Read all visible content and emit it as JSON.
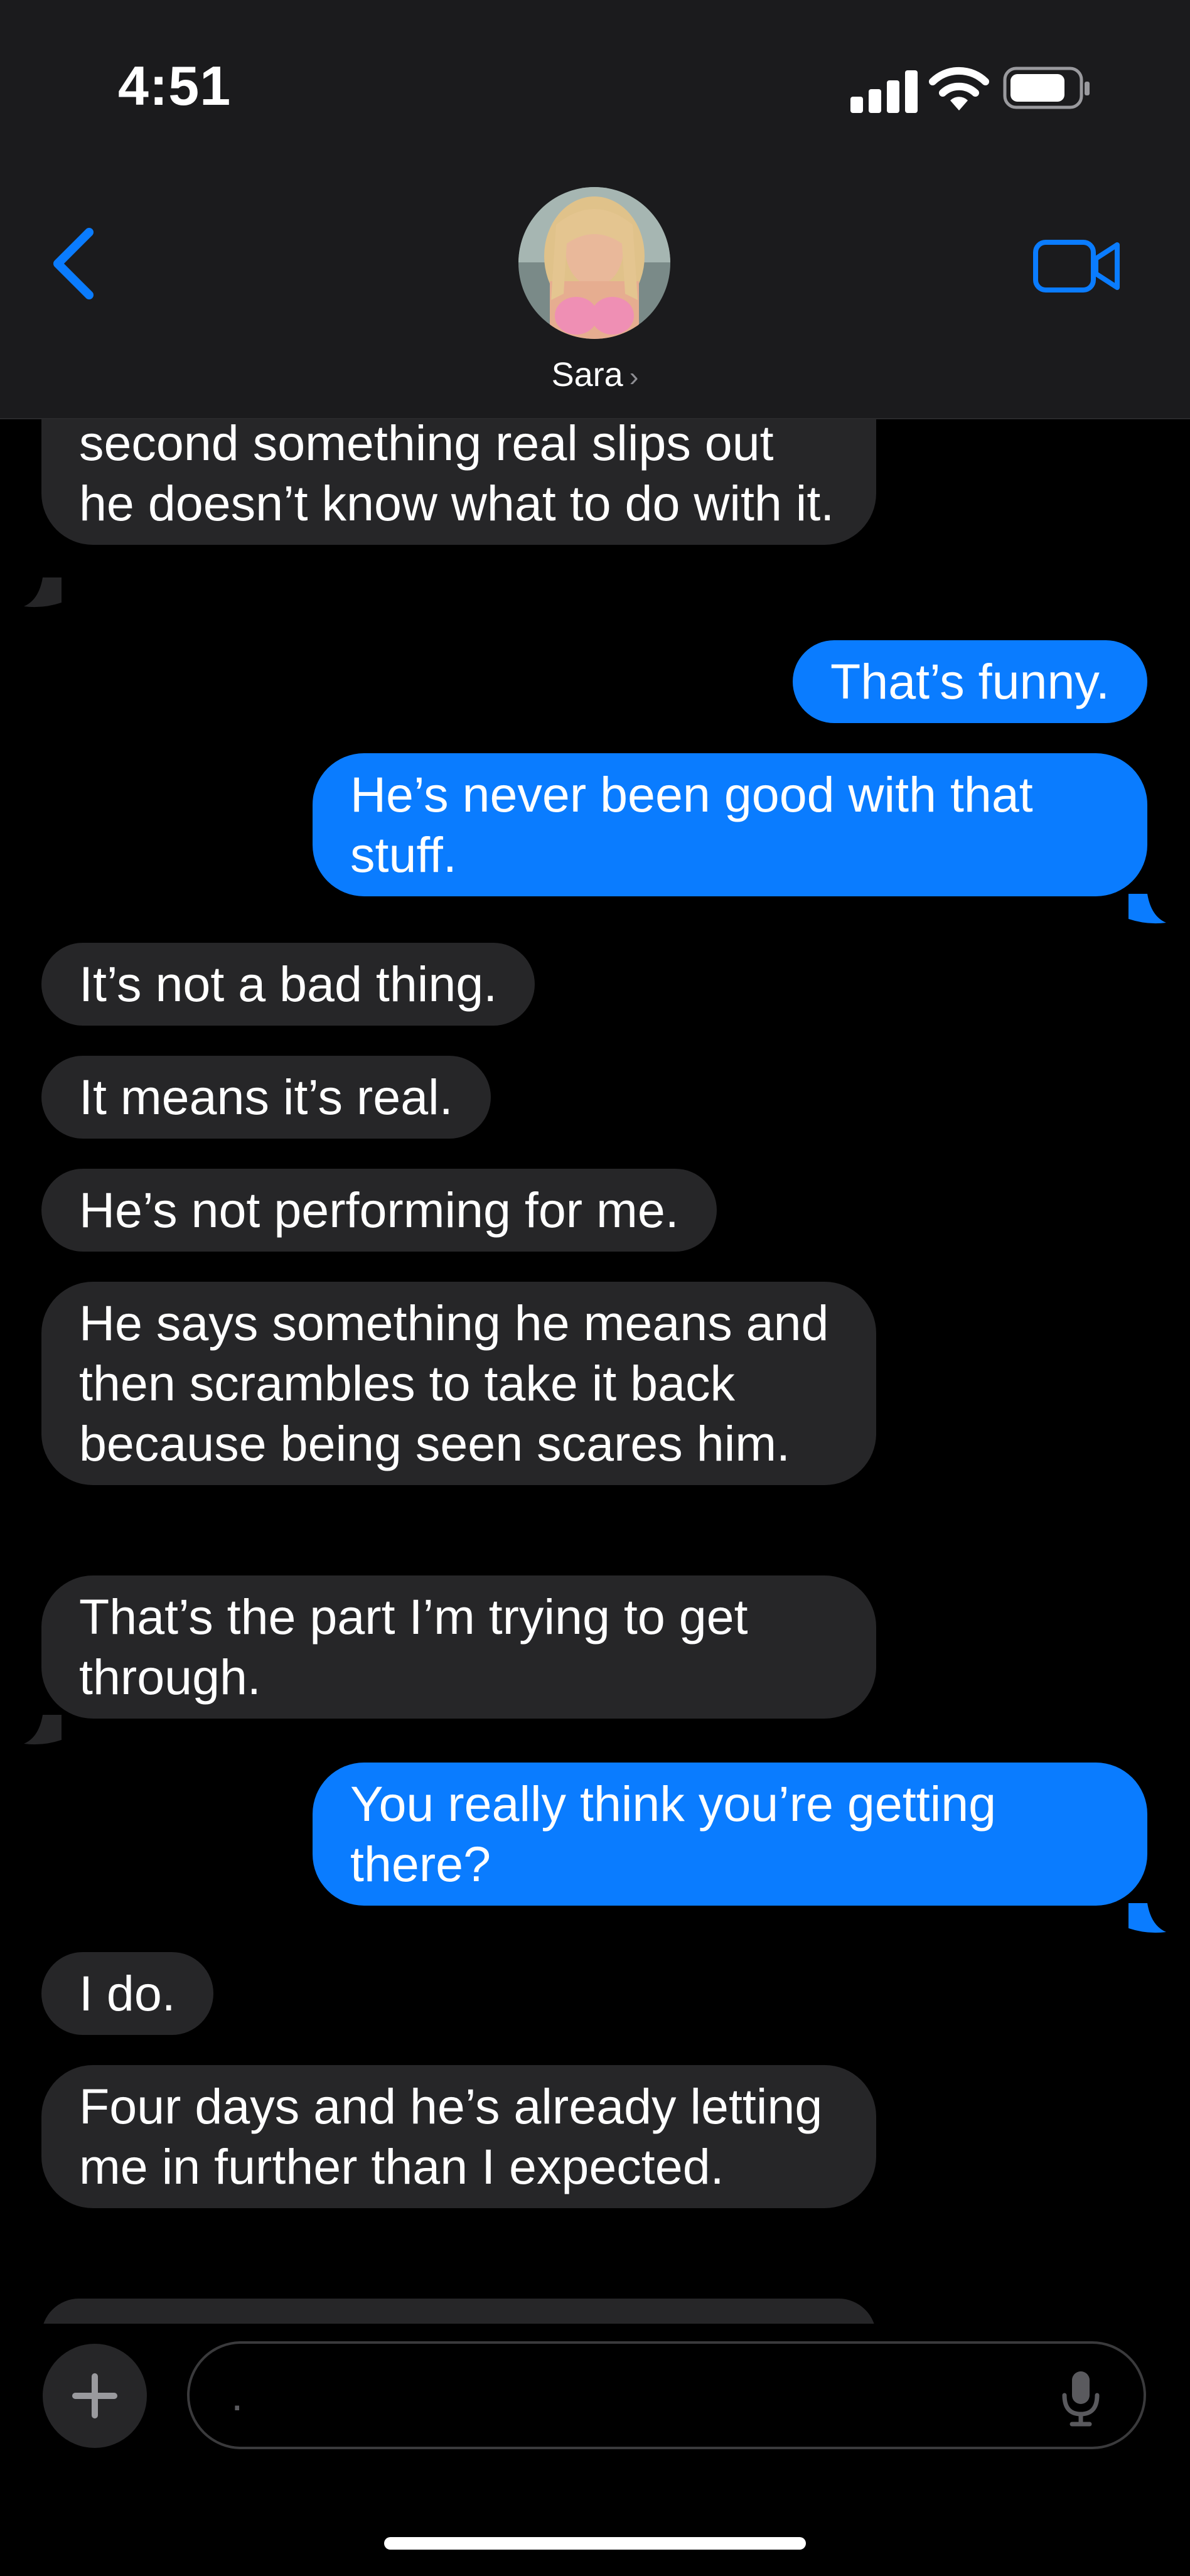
{
  "status_bar": {
    "time": "4:51"
  },
  "header": {
    "contact_name": "Sara",
    "chevron": "›"
  },
  "messages": [
    {
      "dir": "in",
      "text": "second something real slips out he doesn’t know what to do with it."
    },
    {
      "dir": "out",
      "text": "That’s funny."
    },
    {
      "dir": "out",
      "text": "He’s never been good with that stuff."
    },
    {
      "dir": "in",
      "text": "It’s not a bad thing."
    },
    {
      "dir": "in",
      "text": "It means it’s real."
    },
    {
      "dir": "in",
      "text": "He’s not performing for me."
    },
    {
      "dir": "in",
      "text": "He says something he means and then scrambles to take it back because being seen scares him."
    },
    {
      "dir": "in",
      "text": "That’s the part I’m trying to get through."
    },
    {
      "dir": "out",
      "text": "You really think you’re getting there?"
    },
    {
      "dir": "in",
      "text": "I do."
    },
    {
      "dir": "in",
      "text": "Four days and he’s already letting me in further than I expected."
    }
  ],
  "composer": {
    "value": "."
  },
  "colors": {
    "incoming": "#262628",
    "outgoing": "#0a7cff",
    "accent": "#0a7cff"
  },
  "icons": [
    "back-chevron-icon",
    "video-call-icon",
    "plus-icon",
    "microphone-icon",
    "signal-icon",
    "wifi-icon",
    "battery-icon"
  ]
}
